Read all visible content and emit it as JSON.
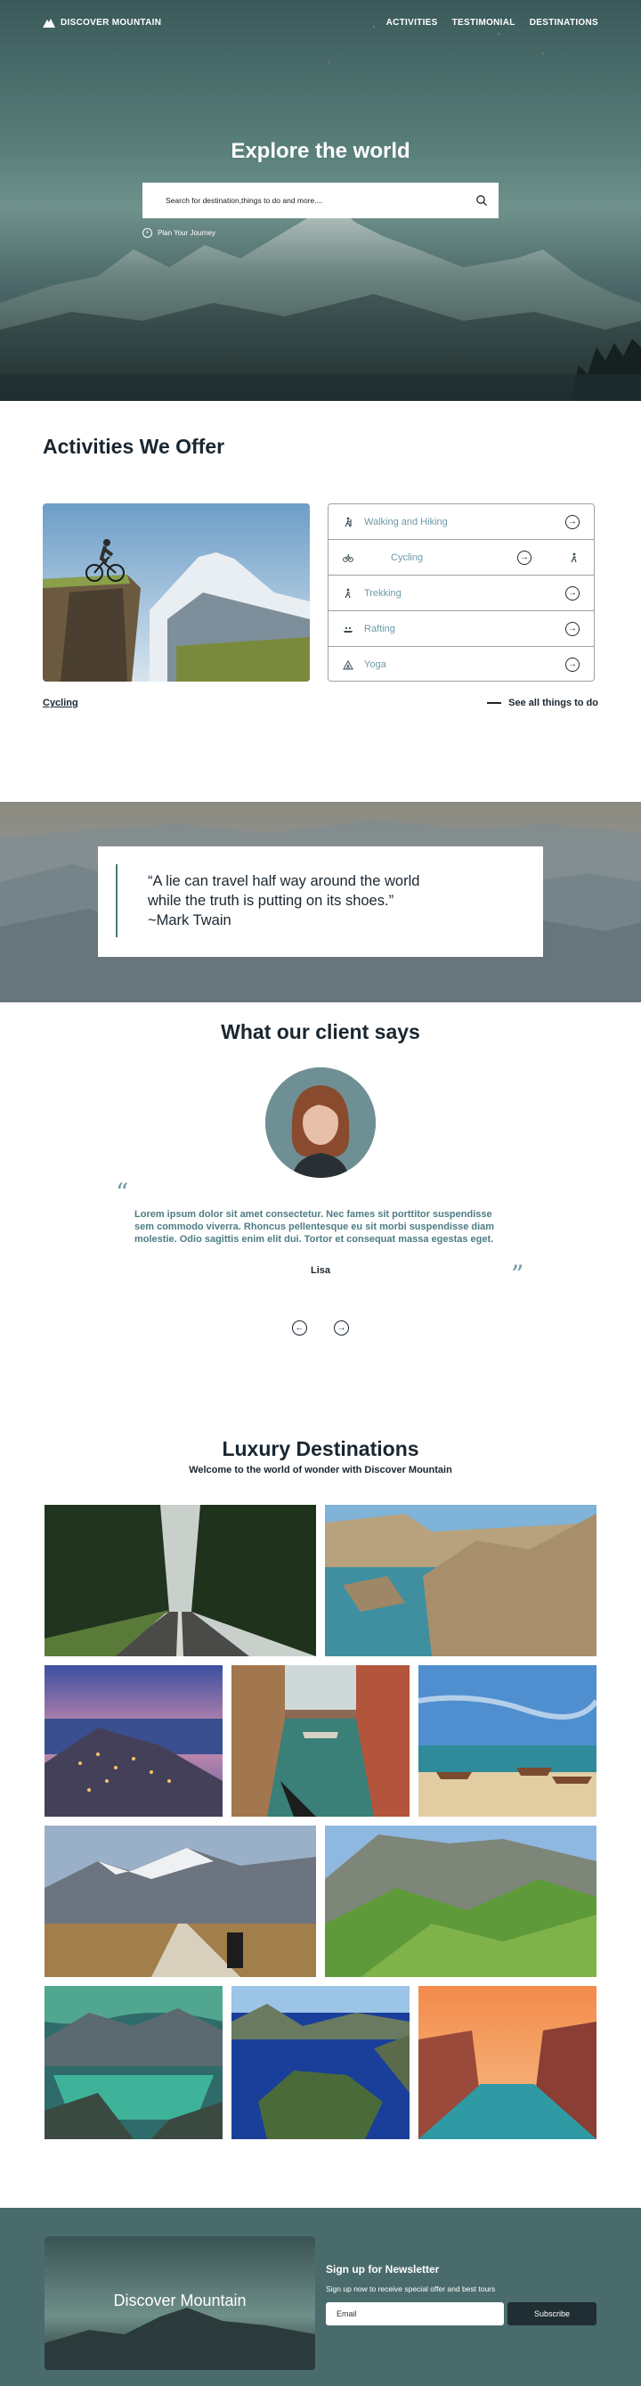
{
  "nav": {
    "brand": "DISCOVER MOUNTAIN",
    "brand_icon": "mountain-logo-icon",
    "links": [
      "ACTIVITIES",
      "TESTIMONIAL",
      "DESTINATIONS"
    ]
  },
  "hero": {
    "title": "Explore the world",
    "search_placeholder": "Search for destination,things to do and more....",
    "search_icon": "search-icon",
    "plan_label": "Plan Your Journey"
  },
  "activities": {
    "heading": "Activities We Offer",
    "items": [
      {
        "label": "Walking and Hiking",
        "icon": "hiker-icon"
      },
      {
        "label": "Cycling",
        "icon": "bicycle-icon"
      },
      {
        "label": "Trekking",
        "icon": "trekker-icon"
      },
      {
        "label": "Rafting",
        "icon": "raft-icon"
      },
      {
        "label": "Yoga",
        "icon": "tent-icon"
      }
    ],
    "current": "Cycling",
    "see_all": "See all things to do"
  },
  "quote": {
    "line1": "“A lie can travel half way around the world",
    "line2": "while the truth is putting on its shoes.”",
    "author": "~Mark Twain"
  },
  "testimonial": {
    "heading": "What our client says",
    "body": "Lorem ipsum dolor sit amet consectetur. Nec fames sit porttitor suspendisse sem commodo viverra. Rhoncus pellentesque eu sit morbi suspendisse diam molestie. Odio sagittis enim elit dui. Tortor et consequat massa egestas eget.",
    "name": "Lisa",
    "open_quote": "“",
    "close_quote": "”"
  },
  "destinations": {
    "heading": "Luxury Destinations",
    "subtitle": "Welcome to the world of wonder with Discover Mountain"
  },
  "newsletter": {
    "card_title": "Discover Mountain",
    "heading": "Sign up for Newsletter",
    "text": "Sign up now to receive special offer and best tours",
    "email_placeholder": "Email",
    "button": "Subscribe"
  },
  "colors": {
    "accent": "#6b9aa7",
    "footer_bg": "#4a6b6c",
    "dark": "#1a2630"
  }
}
